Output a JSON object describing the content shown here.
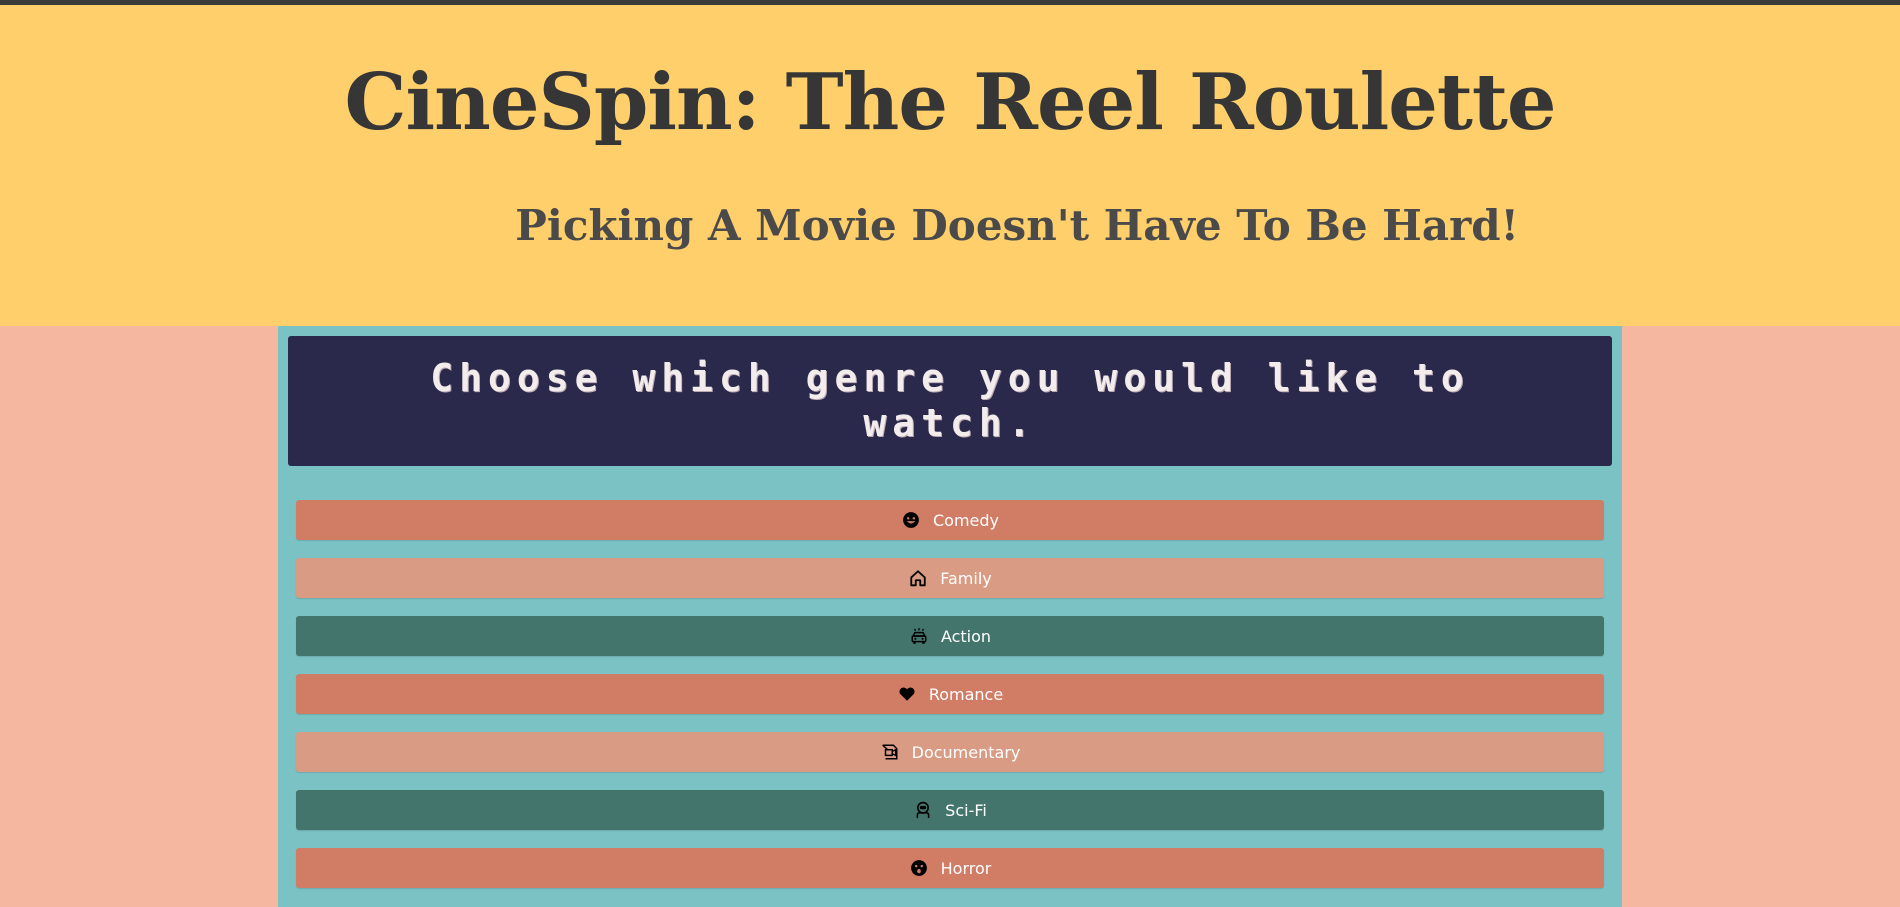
{
  "header": {
    "title": "CineSpin: The Reel Roulette",
    "subtitle": "Picking A Movie Doesn't Have To Be Hard!"
  },
  "prompt": {
    "text": "Choose which genre you would like to watch."
  },
  "genres": [
    {
      "label": "Comedy",
      "icon": "smile-icon",
      "color": "#d17c64"
    },
    {
      "label": "Family",
      "icon": "home-icon",
      "color": "#d99b83"
    },
    {
      "label": "Action",
      "icon": "police-car-icon",
      "color": "#43756d"
    },
    {
      "label": "Romance",
      "icon": "heart-icon",
      "color": "#d17c64"
    },
    {
      "label": "Documentary",
      "icon": "film-projector-icon",
      "color": "#d99b83"
    },
    {
      "label": "Sci-Fi",
      "icon": "astronaut-icon",
      "color": "#43756d"
    },
    {
      "label": "Horror",
      "icon": "scared-face-icon",
      "color": "#d17c64"
    }
  ],
  "colors": {
    "header_bg": "#ffcf6b",
    "page_bg": "#f6b7a0",
    "panel_bg": "#7bc2c4",
    "prompt_bg": "#2b294b"
  }
}
